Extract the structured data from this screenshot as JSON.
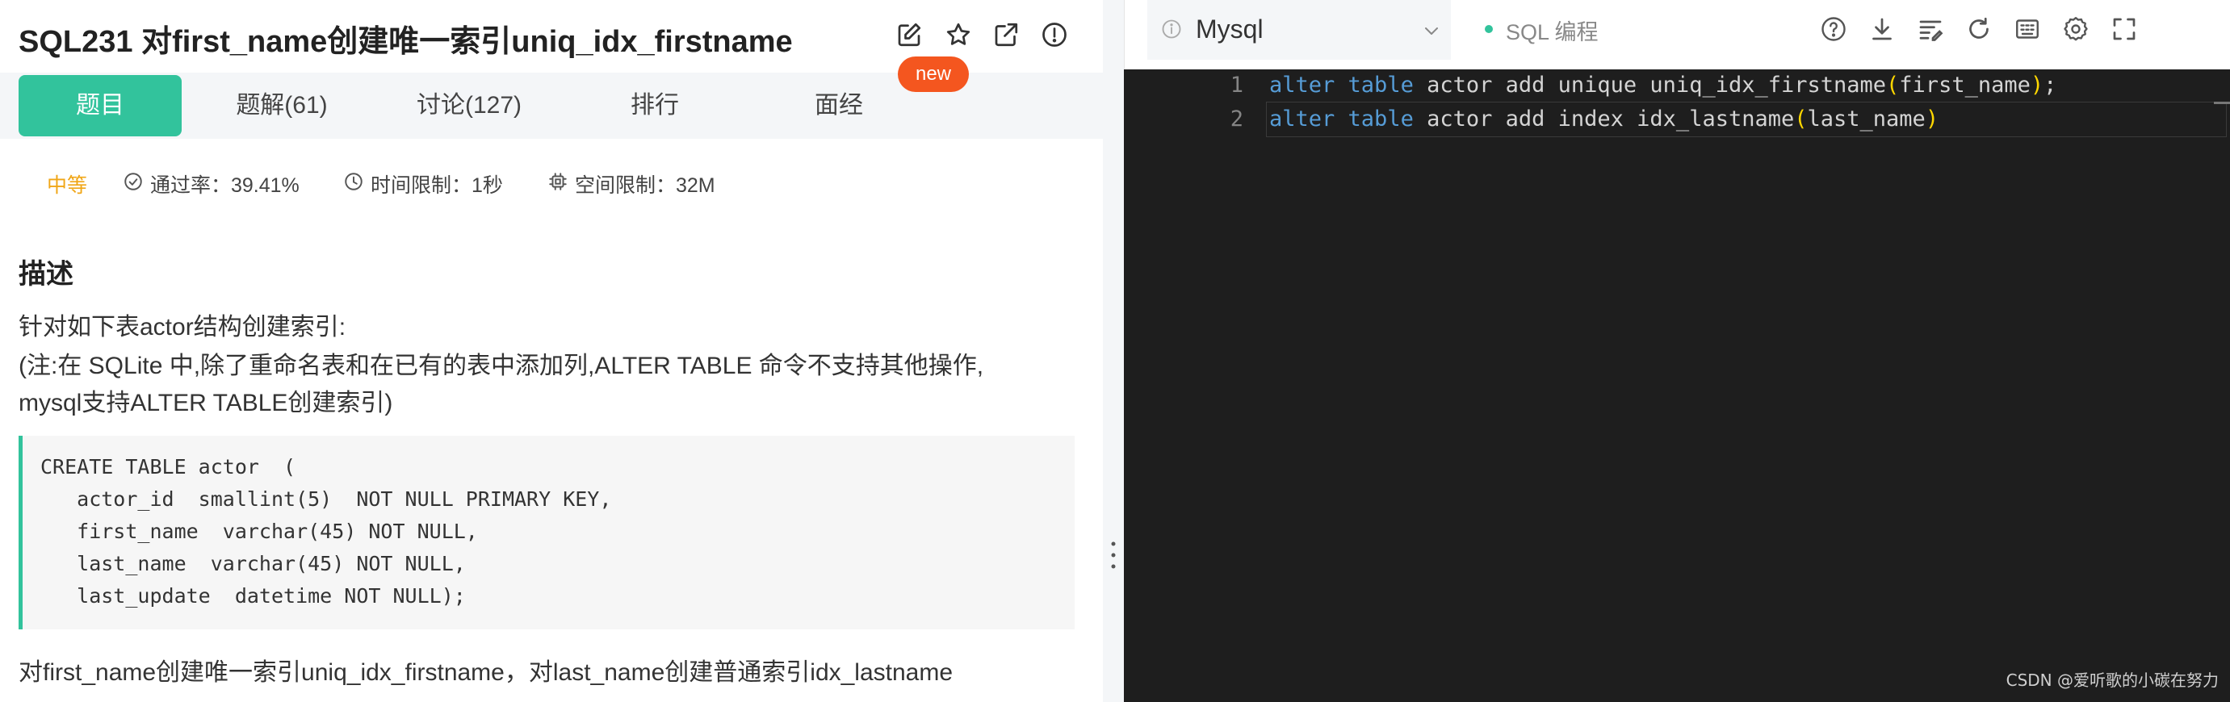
{
  "problem": {
    "title": "SQL231  对first_name创建唯一索引uniq_idx_firstname",
    "new_badge": "new",
    "icons": [
      "edit-icon",
      "star-icon",
      "external-link-icon",
      "report-icon"
    ]
  },
  "tabs": [
    {
      "label": "题目",
      "active": true
    },
    {
      "label": "题解(61)",
      "active": false
    },
    {
      "label": "讨论(127)",
      "active": false
    },
    {
      "label": "排行",
      "active": false
    },
    {
      "label": "面经",
      "active": false
    }
  ],
  "meta": {
    "difficulty": "中等",
    "pass_rate": "通过率：39.41%",
    "time_limit": "时间限制：1秒",
    "space_limit": "空间限制：32M"
  },
  "description": {
    "heading": "描述",
    "line1": "针对如下表actor结构创建索引:",
    "line2": "(注:在 SQLite 中,除了重命名表和在已有的表中添加列,ALTER TABLE 命令不支持其他操作,",
    "line3": "mysql支持ALTER TABLE创建索引)",
    "code": [
      "CREATE TABLE actor  (",
      "   actor_id  smallint(5)  NOT NULL PRIMARY KEY,",
      "   first_name  varchar(45) NOT NULL,",
      "   last_name  varchar(45) NOT NULL,",
      "   last_update  datetime NOT NULL);"
    ],
    "task": "对first_name创建唯一索引uniq_idx_firstname，对last_name创建普通索引idx_lastname"
  },
  "editor": {
    "language": "Mysql",
    "mode": "SQL 编程",
    "toolbar_icons": [
      "help-icon",
      "download-icon",
      "format-icon",
      "reset-icon",
      "shortcut-icon",
      "settings-icon",
      "fullscreen-icon"
    ],
    "lines": [
      {
        "number": "1",
        "kw1": "alter",
        "kw2": "table",
        "rest": " actor add unique uniq_idx_firstname",
        "open": "(",
        "arg": "first_name",
        "close": ")",
        "end": ";"
      },
      {
        "number": "2",
        "kw1": "alter",
        "kw2": "table",
        "rest": " actor add index idx_lastname",
        "open": "(",
        "arg": "last_name",
        "close": ")",
        "end": ""
      }
    ]
  },
  "watermark": "CSDN @爱听歌的小碳在努力",
  "colors": {
    "accent": "#32c39c",
    "badge": "#f4561f",
    "difficulty": "#f0a617",
    "keyword": "#569cd6",
    "paren": "#ffd700",
    "editor_bg": "#1e1e1e"
  }
}
